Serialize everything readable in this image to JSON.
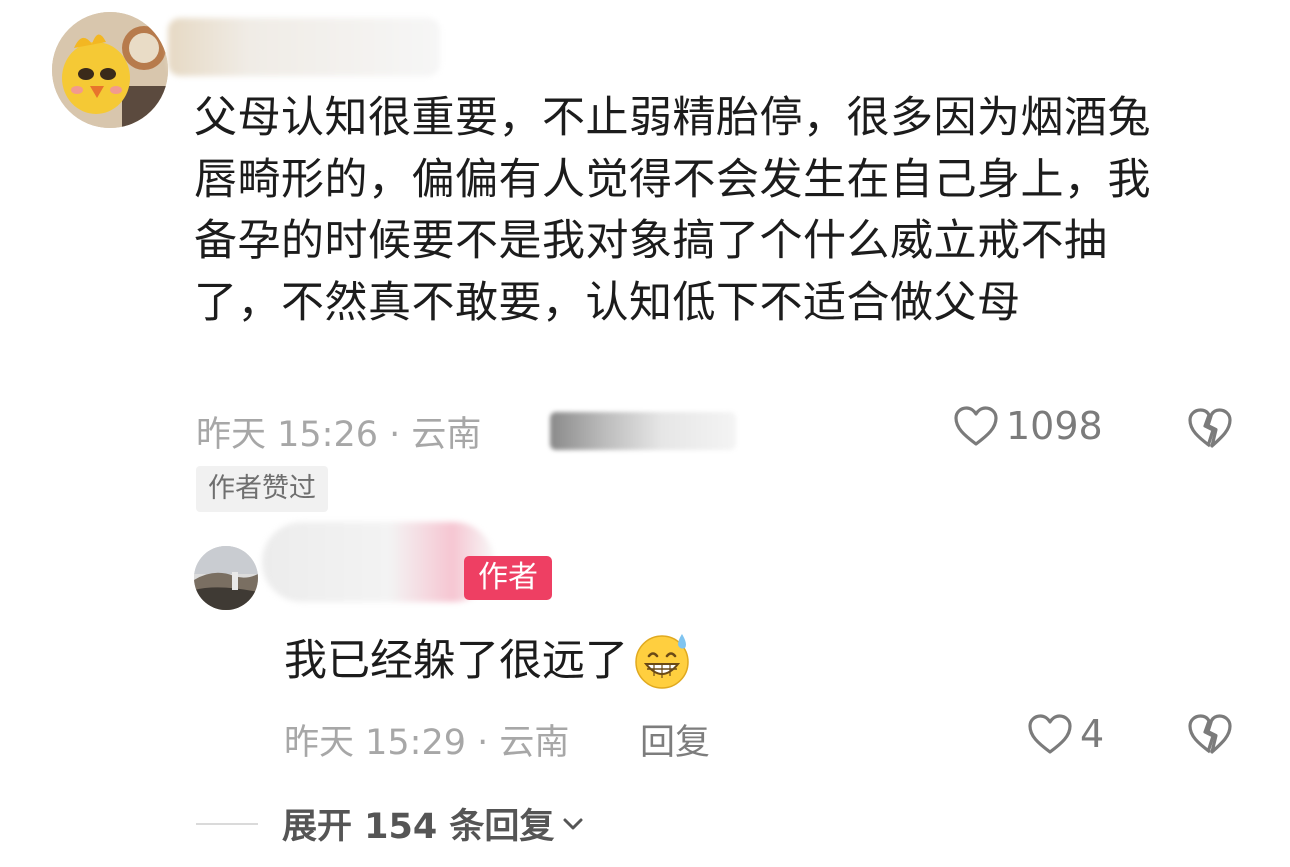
{
  "main_comment": {
    "text": "父母认知很重要，不止弱精胎停，很多因为烟酒兔\n唇畸形的，偏偏有人觉得不会发生在自己身上，我\n备孕的时候要不是我对象搞了个什么威立戒不抽\n了，不然真不敢要，认知低下不适合做父母",
    "time_location": "昨天 15:26 · 云南",
    "like_count": "1098",
    "author_liked_badge": "作者赞过",
    "avatar_icon": "cartoon-chick-avatar"
  },
  "reply": {
    "author_tag": "作者",
    "text": "我已经躲了很远了",
    "emoji": "grinning-sweat-emoji",
    "time_location": "昨天 15:29 · 云南",
    "reply_label": "回复",
    "like_count": "4"
  },
  "expand": {
    "label": "展开 154 条回复"
  },
  "colors": {
    "author_tag_bg": "#ee3f63",
    "meta_text": "#a7a7a7",
    "body_text": "#1c1c1c"
  }
}
